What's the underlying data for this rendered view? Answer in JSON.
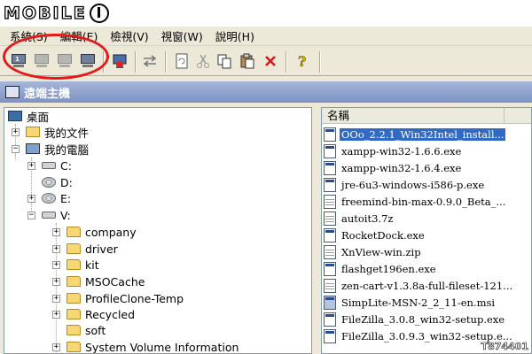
{
  "brand": {
    "logo_text": "MOBILE"
  },
  "menu": [
    "系統(S)",
    "編輯(E)",
    "檢視(V)",
    "視窗(W)",
    "說明(H)"
  ],
  "toolbar": {
    "buttons": [
      {
        "name": "remote-computer-1",
        "label": "1"
      },
      {
        "name": "remote-computer-2"
      },
      {
        "name": "remote-computer-3"
      },
      {
        "name": "remote-computer-4"
      }
    ]
  },
  "panel": {
    "title": "遠端主機"
  },
  "tree": {
    "items": [
      {
        "label": "桌面",
        "icon": "desktop-icon"
      },
      {
        "label": "我的文件",
        "icon": "my-documents-icon"
      },
      {
        "label": "我的電腦",
        "icon": "my-computer-icon"
      },
      {
        "label": "C:",
        "icon": "hard-drive-icon"
      },
      {
        "label": "D:",
        "icon": "cd-drive-icon"
      },
      {
        "label": "E:",
        "icon": "cd-drive-icon"
      },
      {
        "label": "V:",
        "icon": "hard-drive-icon"
      },
      {
        "label": "company",
        "icon": "folder-icon"
      },
      {
        "label": "driver",
        "icon": "folder-icon"
      },
      {
        "label": "kit",
        "icon": "folder-icon"
      },
      {
        "label": "MSOCache",
        "icon": "folder-icon"
      },
      {
        "label": "ProfileClone-Temp",
        "icon": "folder-icon"
      },
      {
        "label": "Recycled",
        "icon": "folder-icon"
      },
      {
        "label": "soft",
        "icon": "folder-icon"
      },
      {
        "label": "System Volume Information",
        "icon": "folder-icon"
      }
    ]
  },
  "file_list": {
    "column_name": "名稱",
    "files": [
      "OOo_2.2.1_Win32Intel_install...",
      "xampp-win32-1.6.6.exe",
      "xampp-win32-1.6.4.exe",
      "jre-6u3-windows-i586-p.exe",
      "freemind-bin-max-0.9.0_Beta_...",
      "autoit3.7z",
      "RocketDock.exe",
      "XnView-win.zip",
      "flashget196en.exe",
      "zen-cart-v1.3.8a-full-fileset-121...",
      "SimpLite-MSN-2_2_11-en.msi",
      "FileZilla_3.0.8_win32-setup.exe",
      "FileZilla_3.0.9.3_win32-setup.e..."
    ],
    "selected_index": 0
  },
  "watermark": "T874401",
  "colors": {
    "selection": "#316ac5",
    "annotation_circle": "#e41b1b",
    "panel_header": "#7c92c4"
  }
}
